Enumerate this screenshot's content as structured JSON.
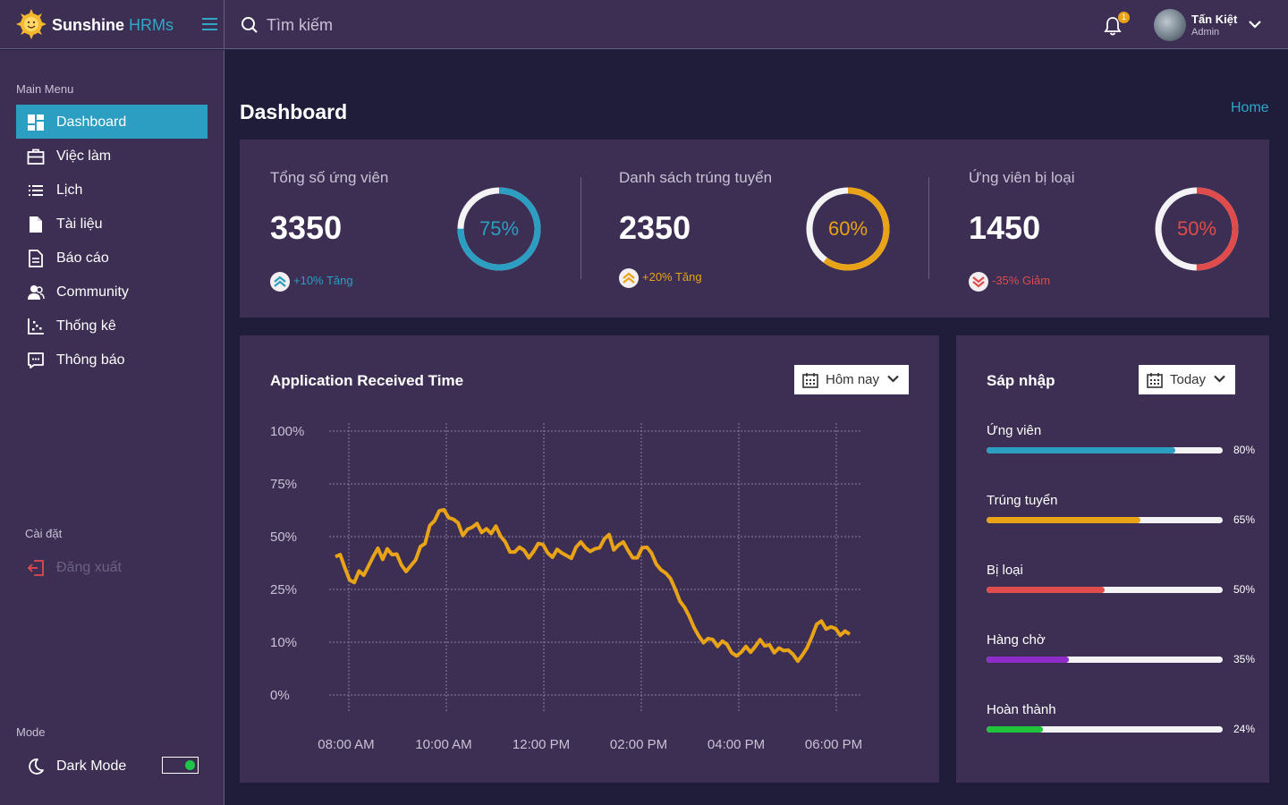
{
  "brand": {
    "name": "Sunshine",
    "suffix": "HRMs"
  },
  "search": {
    "placeholder": "Tìm kiếm"
  },
  "notifications": {
    "count": "1"
  },
  "user": {
    "name": "Tấn Kiệt",
    "role": "Admin"
  },
  "sidebar": {
    "main_menu_label": "Main Menu",
    "items": [
      {
        "label": "Dashboard",
        "icon": "dashboard-icon"
      },
      {
        "label": "Việc làm",
        "icon": "briefcase-icon"
      },
      {
        "label": "Lịch",
        "icon": "list-icon"
      },
      {
        "label": "Tài liệu",
        "icon": "file-icon"
      },
      {
        "label": "Báo cáo",
        "icon": "report-icon"
      },
      {
        "label": "Community",
        "icon": "users-icon"
      },
      {
        "label": "Thống kê",
        "icon": "scatter-chart-icon"
      },
      {
        "label": "Thông báo",
        "icon": "message-icon"
      }
    ],
    "settings_label": "Cài đặt",
    "logout_label": "Đăng xuất",
    "mode_label": "Mode",
    "dark_mode_label": "Dark Mode",
    "dark_mode_on": true
  },
  "page": {
    "title": "Dashboard",
    "breadcrumb": "Home"
  },
  "stats": [
    {
      "title": "Tổng số ứng viên",
      "value": "3350",
      "percent": 75,
      "percent_label": "75%",
      "change": "+10% Tăng",
      "color": "#2b9ec1",
      "trend": "up"
    },
    {
      "title": "Danh sách trúng tuyển",
      "value": "2350",
      "percent": 60,
      "percent_label": "60%",
      "change": "+20% Tăng",
      "color": "#e8a317",
      "trend": "up"
    },
    {
      "title": "Ứng viên bị loại",
      "value": "1450",
      "percent": 50,
      "percent_label": "50%",
      "change": "-35% Giảm",
      "color": "#e04b4b",
      "trend": "down"
    }
  ],
  "chart_card": {
    "title": "Application Received Time",
    "dropdown": "Hôm nay"
  },
  "chart_data": {
    "type": "line",
    "title": "Application Received Time",
    "y_tick_labels": [
      "100%",
      "75%",
      "50%",
      "25%",
      "10%",
      "0%"
    ],
    "x_tick_labels": [
      "08:00 AM",
      "10:00 AM",
      "12:00 PM",
      "02:00 PM",
      "04:00 PM",
      "06:00 PM"
    ],
    "grid": true,
    "color": "#e8a317",
    "series": [
      {
        "values": [
          2.62,
          2.66,
          2.41,
          2.18,
          2.13,
          2.35,
          2.27,
          2.44,
          2.62,
          2.78,
          2.57,
          2.77,
          2.66,
          2.67,
          2.46,
          2.34,
          2.45,
          2.56,
          2.81,
          2.87,
          3.21,
          3.3,
          3.49,
          3.51,
          3.36,
          3.33,
          3.26,
          3.02,
          3.14,
          3.18,
          3.25,
          3.08,
          3.15,
          3.06,
          3.2,
          3.01,
          2.9,
          2.71,
          2.71,
          2.8,
          2.74,
          2.6,
          2.72,
          2.87,
          2.85,
          2.69,
          2.61,
          2.76,
          2.69,
          2.64,
          2.59,
          2.8,
          2.9,
          2.79,
          2.72,
          2.77,
          2.79,
          2.96,
          3.04,
          2.75,
          2.84,
          2.9,
          2.74,
          2.6,
          2.6,
          2.79,
          2.8,
          2.69,
          2.48,
          2.37,
          2.31,
          2.21,
          2.01,
          1.78,
          1.66,
          1.49,
          1.28,
          1.12,
          0.99,
          1.07,
          1.05,
          0.92,
          1.02,
          0.96,
          0.8,
          0.74,
          0.81,
          0.92,
          0.81,
          0.92,
          1.05,
          0.93,
          0.95,
          0.8,
          0.89,
          0.84,
          0.85,
          0.77,
          0.64,
          0.76,
          0.9,
          1.11,
          1.34,
          1.4,
          1.25,
          1.29,
          1.26,
          1.13,
          1.21,
          1.15
        ]
      }
    ]
  },
  "merge_card": {
    "title": "Sáp nhập",
    "dropdown": "Today",
    "items": [
      {
        "label": "Ứng viên",
        "value": 80,
        "pct": "80%",
        "color": "#2b9ec1"
      },
      {
        "label": "Trúng tuyển",
        "value": 65,
        "pct": "65%",
        "color": "#e8a317"
      },
      {
        "label": "Bị loại",
        "value": 50,
        "pct": "50%",
        "color": "#e04b4b"
      },
      {
        "label": "Hàng chờ",
        "value": 35,
        "pct": "35%",
        "color": "#8e2bc9"
      },
      {
        "label": "Hoàn thành",
        "value": 24,
        "pct": "24%",
        "color": "#1fc43a"
      }
    ]
  }
}
